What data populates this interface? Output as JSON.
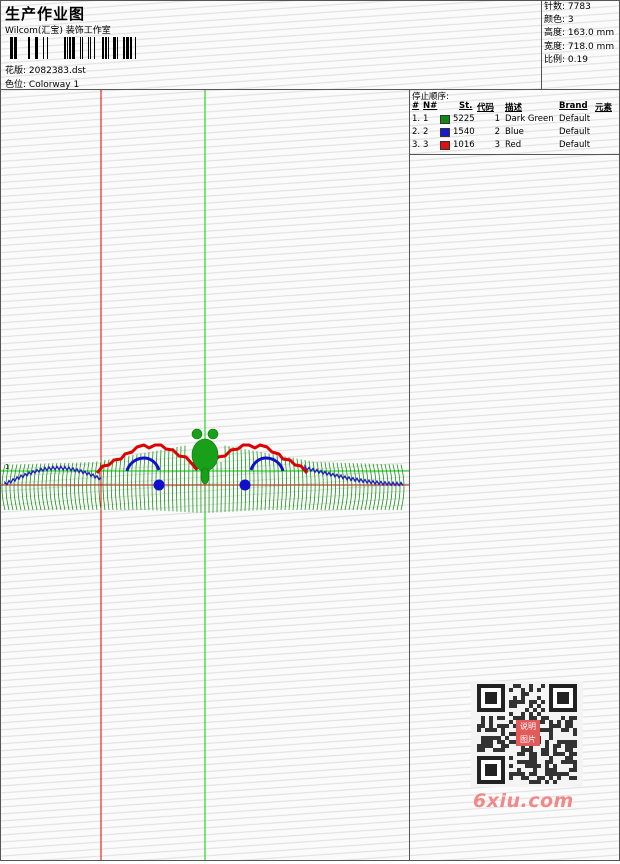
{
  "header": {
    "title": "生产作业图",
    "company": "Wilcom(汇宝) 装饰工作室",
    "design_label": "花版:",
    "design_file": "2082383.dst",
    "colorway_label": "色位:",
    "colorway": "Colorway 1"
  },
  "stats": [
    {
      "label": "针数:",
      "value": "7783"
    },
    {
      "label": "颜色:",
      "value": "3"
    },
    {
      "label": "高度:",
      "value": "163.0 mm"
    },
    {
      "label": "宽度:",
      "value": "718.0 mm"
    },
    {
      "label": "比例:",
      "value": "0.19"
    }
  ],
  "stops": {
    "caption": "停止顺序:",
    "columns": [
      "#",
      "N#",
      "St.",
      "代码",
      "描述",
      "Brand",
      "元素"
    ],
    "rows": [
      {
        "num": "1.",
        "nn": "1",
        "color": "#118811",
        "st": "5225",
        "code": "1",
        "desc": "Dark Green",
        "brand": "Default"
      },
      {
        "num": "2.",
        "nn": "2",
        "color": "#1a1acc",
        "st": "1540",
        "code": "2",
        "desc": "Blue",
        "brand": "Default"
      },
      {
        "num": "3.",
        "nn": "3",
        "color": "#dd1111",
        "st": "1016",
        "code": "3",
        "desc": "Red",
        "brand": "Default"
      }
    ]
  },
  "guides": {
    "origin_marker": "1"
  },
  "watermark": {
    "text": "6xiu.com",
    "stamp": "说明 图片"
  }
}
